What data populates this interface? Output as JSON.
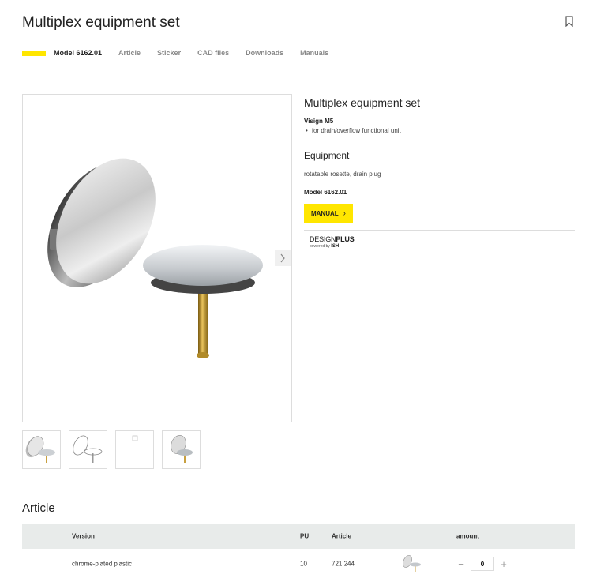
{
  "header": {
    "title": "Multiplex equipment set"
  },
  "subnav": {
    "items": [
      {
        "label": "Model 6162.01",
        "active": true
      },
      {
        "label": "Article"
      },
      {
        "label": "Sticker"
      },
      {
        "label": "CAD files"
      },
      {
        "label": "Downloads"
      },
      {
        "label": "Manuals"
      }
    ]
  },
  "product": {
    "title": "Multiplex equipment set",
    "subtitle": "Visign M5",
    "bullets": [
      "for drain/overflow functional unit"
    ],
    "equipment_heading": "Equipment",
    "equipment_text": "rotatable rosette, drain plug",
    "model": "Model 6162.01",
    "manual_button": "MANUAL",
    "award": {
      "brand": "DESIGN",
      "brand_bold": "PLUS",
      "powered_by": "powered by",
      "powered_brand": "ISH"
    }
  },
  "gallery": {
    "thumbnails": [
      "thumb-plug-set",
      "thumb-outline",
      "thumb-broken",
      "thumb-plug-set-small"
    ]
  },
  "article": {
    "title": "Article",
    "columns": {
      "version": "Version",
      "pu": "PU",
      "article": "Article",
      "amount": "amount"
    },
    "rows": [
      {
        "version": "chrome-plated plastic",
        "pu": "10",
        "article": "721 244",
        "amount": "0"
      }
    ]
  },
  "colors": {
    "accent": "#ffe600",
    "table_header": "#e8ebea",
    "border": "#dddddd"
  }
}
